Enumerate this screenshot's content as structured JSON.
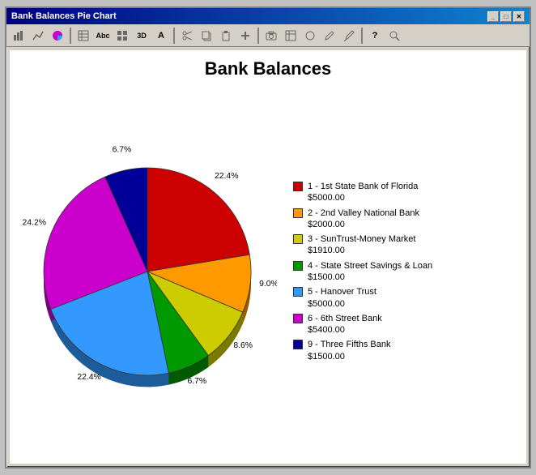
{
  "window": {
    "title": "Bank Balances Pie Chart",
    "close_label": "✕",
    "minimize_label": "_",
    "maximize_label": "□"
  },
  "chart": {
    "title": "Bank Balances",
    "segments": [
      {
        "id": 1,
        "label": "1 - 1st State Bank of Florida",
        "amount": "$5000.00",
        "color": "#cc0000",
        "percent": 22.4,
        "percent_label": "22.4%",
        "start_angle": 0
      },
      {
        "id": 2,
        "label": "2 - 2nd Valley National Bank",
        "amount": "$2000.00",
        "color": "#ff9900",
        "percent": 9.0,
        "percent_label": "9.0%",
        "start_angle": 80.64
      },
      {
        "id": 3,
        "label": "3 - SunTrust-Money Market",
        "amount": "$1910.00",
        "color": "#cccc00",
        "percent": 8.6,
        "percent_label": "8.6%",
        "start_angle": 113.04
      },
      {
        "id": 4,
        "label": "4 - State Street Savings & Loan",
        "amount": "$1500.00",
        "color": "#009900",
        "percent": 6.7,
        "percent_label": "6.7%",
        "start_angle": 143.96
      },
      {
        "id": 5,
        "label": "5 - Hanover Trust",
        "amount": "$5000.00",
        "color": "#3399ff",
        "percent": 22.4,
        "percent_label": "22.4%",
        "start_angle": 168.08
      },
      {
        "id": 6,
        "label": "6 - 6th Street Bank",
        "amount": "$5400.00",
        "color": "#cc00cc",
        "percent": 24.2,
        "percent_label": "24.2%",
        "start_angle": 248.72
      },
      {
        "id": 9,
        "label": "9 - Three Fifths Bank",
        "amount": "$1500.00",
        "color": "#000099",
        "percent": 6.7,
        "percent_label": "6.7%",
        "start_angle": 335.84
      }
    ]
  },
  "toolbar": {
    "buttons": [
      "📊",
      "📈",
      "📉",
      "▤",
      "Abc",
      "▦",
      "3D",
      "A",
      "✂",
      "📋",
      "✂",
      "📋",
      "➕",
      "📷",
      "▦",
      "◯",
      "✏",
      "🖊",
      "?",
      "🔍"
    ]
  }
}
